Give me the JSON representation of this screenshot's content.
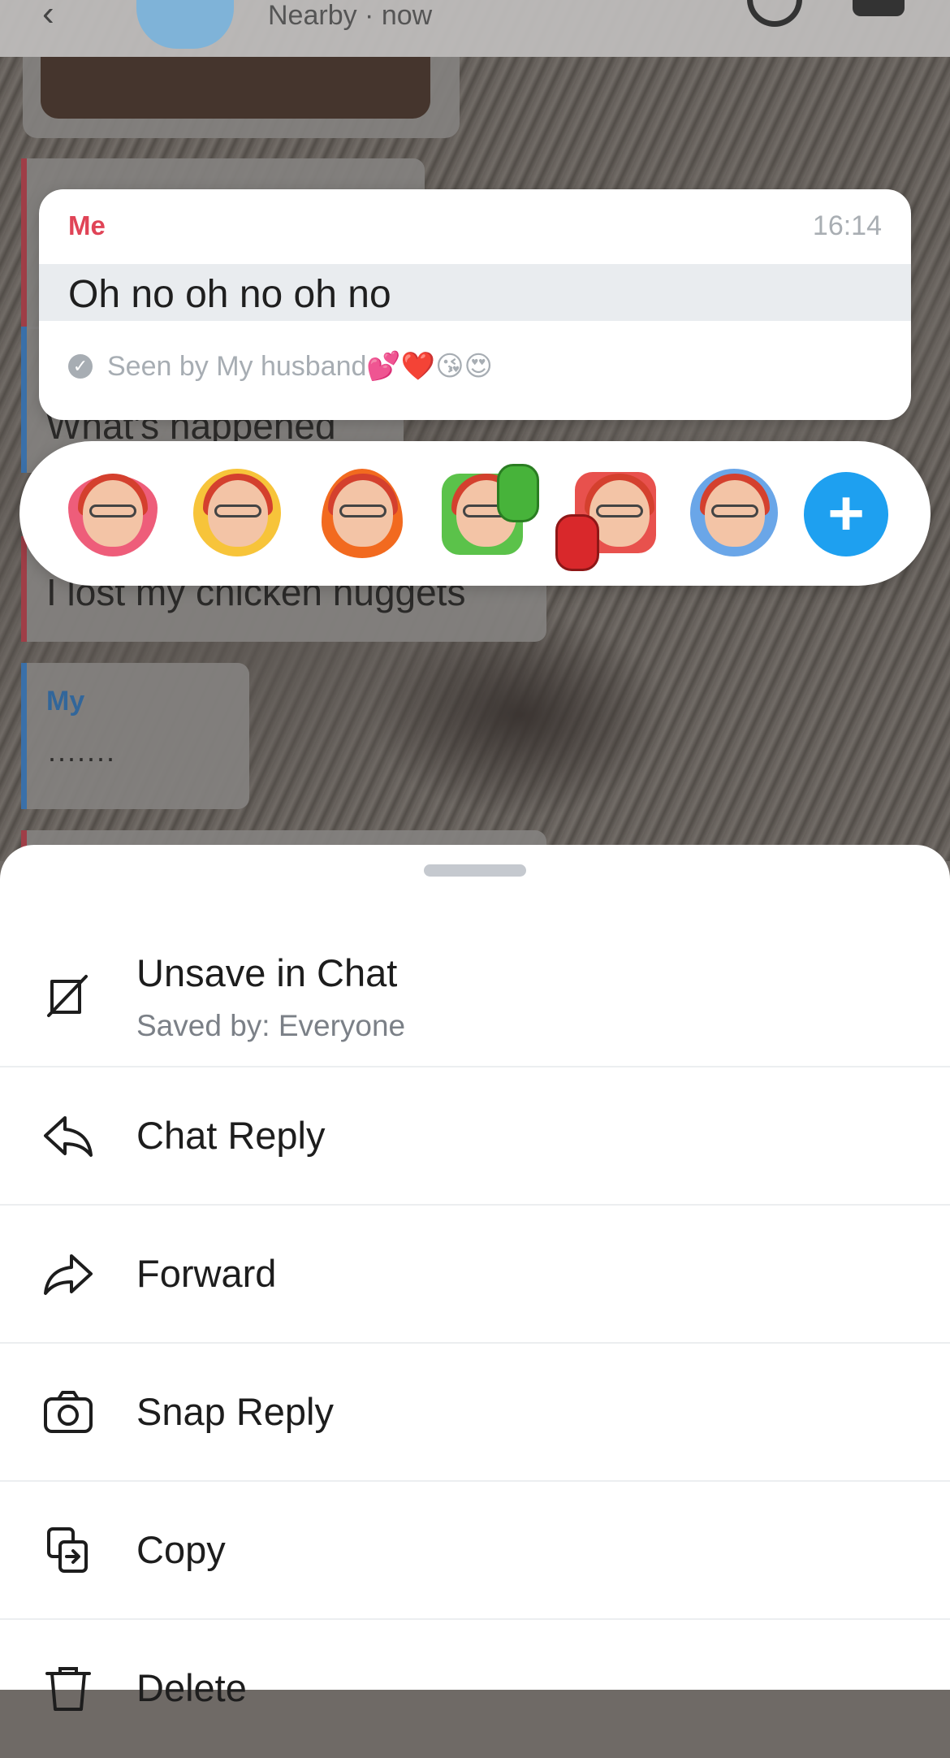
{
  "header": {
    "status": "Nearby · now"
  },
  "background_chat": {
    "message_chicken": "I lost my chicken nuggets",
    "message_happened": "What's happened",
    "sender_my": "My",
    "message_dots": "......."
  },
  "focused_message": {
    "sender": "Me",
    "time": "16:14",
    "text": "Oh no oh no oh no",
    "seen": "Seen by My husband💕❤️😘😍",
    "sender_color": "#e04457"
  },
  "reactions": {
    "items": [
      {
        "icon": "heart-bitmoji-icon"
      },
      {
        "icon": "laughing-tears-bitmoji-icon"
      },
      {
        "icon": "fire-bitmoji-icon"
      },
      {
        "icon": "thumbs-up-bitmoji-icon"
      },
      {
        "icon": "thumbs-down-bitmoji-icon"
      },
      {
        "icon": "sad-tear-bitmoji-icon"
      }
    ],
    "add_icon": "plus-icon",
    "add_color": "#1ea0f0"
  },
  "actions": {
    "unsave": {
      "label": "Unsave in Chat",
      "sub": "Saved by: Everyone",
      "icon": "unsave-icon"
    },
    "chat_reply": {
      "label": "Chat Reply",
      "icon": "reply-arrow-icon"
    },
    "forward": {
      "label": "Forward",
      "icon": "forward-arrow-icon"
    },
    "snap_reply": {
      "label": "Snap Reply",
      "icon": "camera-icon"
    },
    "copy": {
      "label": "Copy",
      "icon": "copy-icon"
    },
    "delete": {
      "label": "Delete",
      "icon": "trash-icon"
    }
  }
}
